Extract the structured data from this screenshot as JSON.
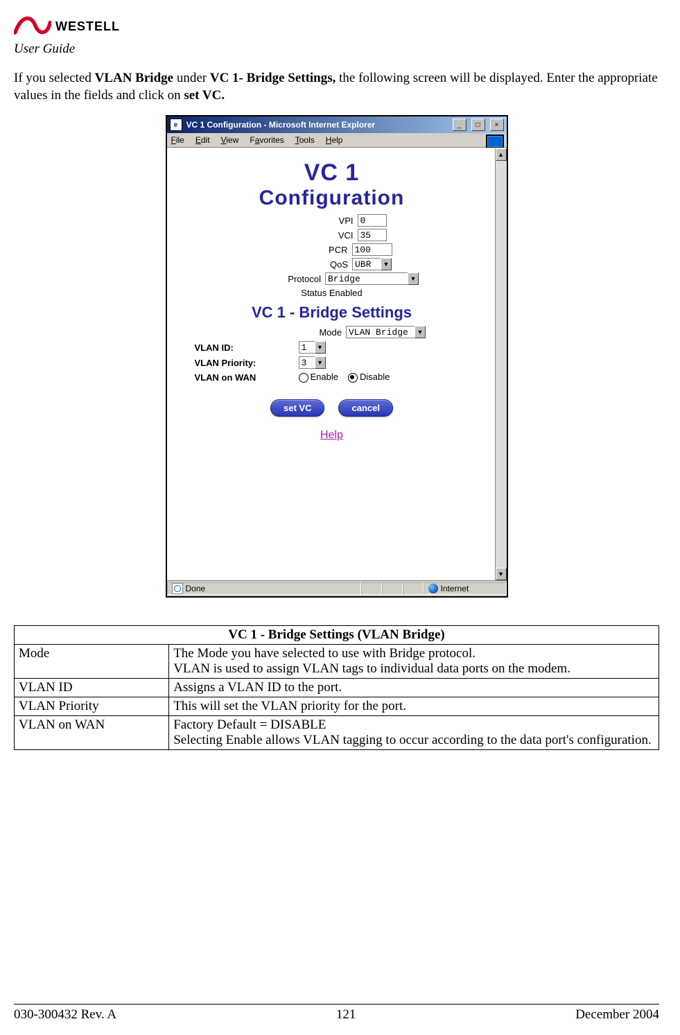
{
  "header": {
    "brand": "WESTELL",
    "guide": "User Guide"
  },
  "intro": {
    "pre": "If you selected ",
    "b1": "VLAN Bridge",
    "mid1": " under ",
    "b2": "VC 1- Bridge Settings,",
    "mid2": " the following screen will be displayed. Enter the appropriate values in the fields and click on ",
    "b3": "set VC."
  },
  "window": {
    "title": "VC 1 Configuration - Microsoft Internet Explorer",
    "menus": {
      "file": "File",
      "edit": "Edit",
      "view": "View",
      "favorites": "Favorites",
      "tools": "Tools",
      "help": "Help"
    },
    "heading_line1": "VC 1",
    "heading_line2": "Configuration",
    "form": {
      "vpi_label": "VPI",
      "vpi_value": "0",
      "vci_label": "VCI",
      "vci_value": "35",
      "pcr_label": "PCR",
      "pcr_value": "100",
      "qos_label": "QoS",
      "qos_value": "UBR",
      "protocol_label": "Protocol",
      "protocol_value": "Bridge",
      "status_label": "Status",
      "status_value": "Enabled"
    },
    "bridge_heading": "VC 1 - Bridge Settings",
    "bridge": {
      "mode_label": "Mode",
      "mode_value": "VLAN Bridge",
      "vlan_id_label": "VLAN ID:",
      "vlan_id_value": "1",
      "vlan_priority_label": "VLAN Priority:",
      "vlan_priority_value": "3",
      "vlan_wan_label": "VLAN on WAN",
      "enable_label": "Enable",
      "disable_label": "Disable",
      "wan_selected": "disable"
    },
    "buttons": {
      "set_vc": "set VC",
      "cancel": "cancel"
    },
    "help_link": "Help",
    "statusbar": {
      "done": "Done",
      "zone": "Internet"
    },
    "scroll_up": "▲",
    "scroll_down": "▼",
    "dropdown_arrow": "▼",
    "minimize": "_",
    "maximize": "□",
    "close": "×"
  },
  "table": {
    "caption": "VC 1 - Bridge Settings (VLAN Bridge)",
    "rows": [
      {
        "k": "Mode",
        "v": "The Mode you have selected to use with Bridge protocol.\nVLAN is used to assign VLAN tags to individual data ports on the modem."
      },
      {
        "k": "VLAN ID",
        "v": "Assigns a VLAN ID to the port."
      },
      {
        "k": "VLAN Priority",
        "v": "This will set the VLAN priority for the port."
      },
      {
        "k": "VLAN on WAN",
        "v": "Factory Default = DISABLE\nSelecting Enable allows VLAN tagging to occur according to the data port's configuration."
      }
    ]
  },
  "footer": {
    "left": "030-300432 Rev. A",
    "center": "121",
    "right": "December 2004"
  }
}
